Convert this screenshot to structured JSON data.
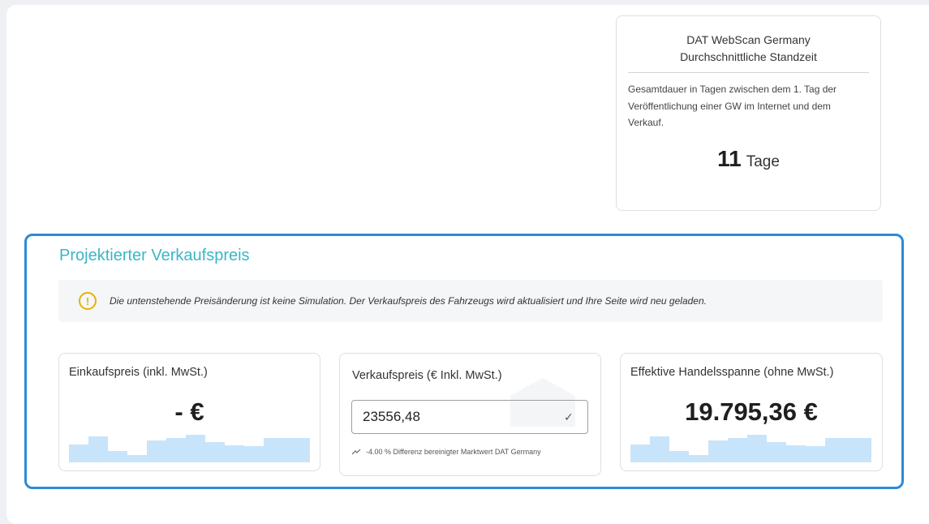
{
  "dat_card": {
    "title": "DAT WebScan Germany",
    "subtitle": "Durchschnittliche Standzeit",
    "description": "Gesamtdauer in Tagen zwischen dem 1. Tag der Veröffentlichung einer GW im Internet und dem Verkauf.",
    "value": "11",
    "unit": "Tage"
  },
  "projected": {
    "title": "Projektierter Verkaufspreis",
    "notice": "Die untenstehende Preisänderung ist keine Simulation. Der Verkaufspreis des Fahrzeugs wird aktualisiert und Ihre Seite wird neu geladen.",
    "purchase": {
      "label": "Einkaufspreis (inkl. MwSt.)",
      "value": "- €"
    },
    "sale": {
      "label": "Verkaufspreis (€ Inkl. MwSt.)",
      "input_value": "23556,48",
      "difference": "-4.00 % Differenz bereinigter Marktwert DAT Germany"
    },
    "margin": {
      "label": "Effektive Handelsspanne (ohne MwSt.)",
      "value": "19.795,36 €"
    }
  },
  "colors": {
    "accent": "#2c8ad8",
    "title_teal": "#3bb6c4",
    "warning": "#e6b400",
    "sparkline": "#c8e4fa"
  },
  "icons": [
    "warning-icon",
    "check-icon",
    "trend-up-icon"
  ]
}
